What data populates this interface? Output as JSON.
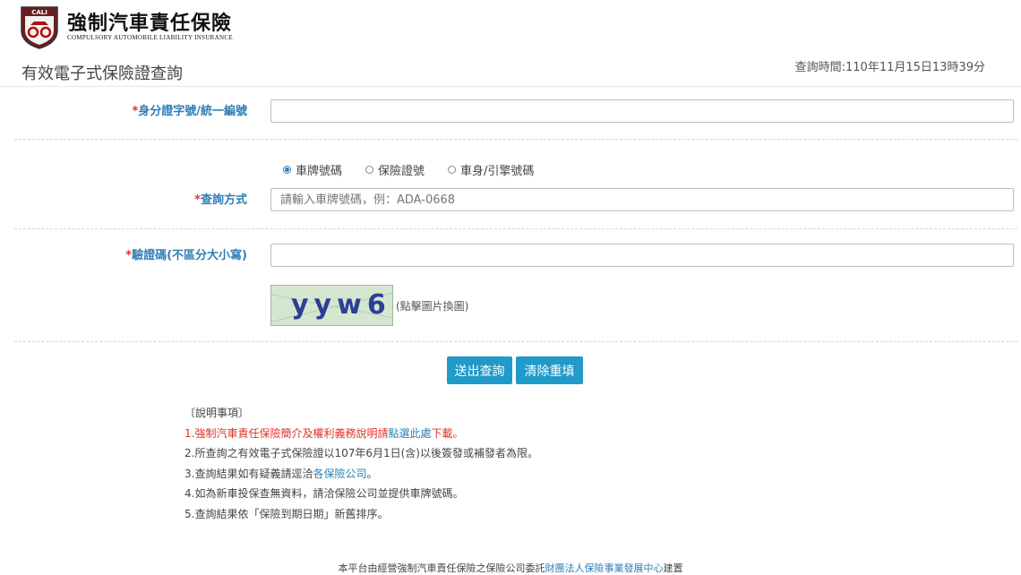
{
  "brand": {
    "logo_text": "CALI",
    "title": "強制汽車責任保險",
    "subtitle": "COMPULSORY AUTOMOBILE LIABILITY INSURANCE"
  },
  "page": {
    "title": "有效電子式保險證查詢",
    "query_time": "查詢時間:110年11月15日13時39分"
  },
  "form": {
    "id_label": "身分證字號/統一編號",
    "id_value": "",
    "method_label": "查詢方式",
    "options": [
      "車牌號碼",
      "保險證號",
      "車身/引擎號碼"
    ],
    "selected_option": "車牌號碼",
    "method_placeholder": "請輸入車牌號碼，例：ADA-0668",
    "captcha_label": "驗證碼(不區分大小寫)",
    "captcha_value": "",
    "captcha_text": "yyw6",
    "captcha_hint": "(點擊圖片換圖)",
    "submit": "送出查詢",
    "clear": "清除重填",
    "required_mark": "*"
  },
  "notes": {
    "heading": "〔說明事項〕",
    "n1_a": "1.強制汽車責任保險簡介及權利義務說明請",
    "n1_link": "點選此處",
    "n1_b": "下載。",
    "n2": "2.所查詢之有效電子式保險證以107年6月1日(含)以後簽發或補發者為限。",
    "n3_a": "3.查詢結果如有疑義請逕洽",
    "n3_link": "各保險公司",
    "n3_b": "。",
    "n4": "4.如為新車投保查無資料，請洽保險公司並提供車牌號碼。",
    "n5": "5.查詢結果依「保險到期日期」新舊排序。"
  },
  "footer": {
    "text_a": "本平台由經營強制汽車責任保險之保險公司委託",
    "link": "財團法人保險事業發展中心",
    "text_b": "建置"
  },
  "colors": {
    "accent": "#2e7fb5",
    "button": "#1f9ac9",
    "required": "#e0302a"
  }
}
